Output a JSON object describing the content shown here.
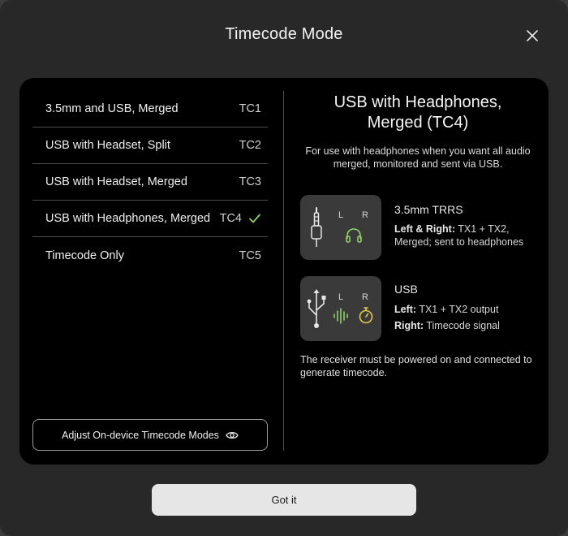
{
  "dialog": {
    "title": "Timecode Mode",
    "close_icon": "close-icon",
    "confirm_label": "Got it"
  },
  "modes": [
    {
      "label": "3.5mm and USB, Merged",
      "code": "TC1",
      "selected": false
    },
    {
      "label": "USB with Headset, Split",
      "code": "TC2",
      "selected": false
    },
    {
      "label": "USB with Headset, Merged",
      "code": "TC3",
      "selected": false
    },
    {
      "label": "USB with Headphones, Merged",
      "code": "TC4",
      "selected": true
    },
    {
      "label": "Timecode Only",
      "code": "TC5",
      "selected": false
    }
  ],
  "adjust": {
    "label": "Adjust On-device Timecode Modes",
    "icon": "eye-icon"
  },
  "detail": {
    "title_line1": "USB with Headphones,",
    "title_line2": "Merged (TC4)",
    "description": "For use with headphones when you want all audio merged, monitored and sent via USB.",
    "connections": [
      {
        "name": "3.5mm TRRS",
        "left_label": "L",
        "right_label": "R",
        "icon": "trrs-jack-icon",
        "output_icon": "headphones-icon",
        "line1_key": "Left & Right:",
        "line1_val": " TX1 + TX2,",
        "line2": "Merged; sent to headphones"
      },
      {
        "name": "USB",
        "left_label": "L",
        "right_label": "R",
        "icon": "usb-icon",
        "left_icon": "audio-waveform-icon",
        "right_icon": "stopwatch-icon",
        "line1_key": "Left:",
        "line1_val": " TX1 + TX2 output",
        "line2_key": "Right:",
        "line2_val": " Timecode signal"
      }
    ],
    "note": "The receiver must be powered on and connected to generate timecode."
  },
  "colors": {
    "accent_green": "#8fd16a",
    "accent_yellow": "#e3c84a",
    "card_bg": "#000000",
    "dialog_bg": "#282828"
  }
}
